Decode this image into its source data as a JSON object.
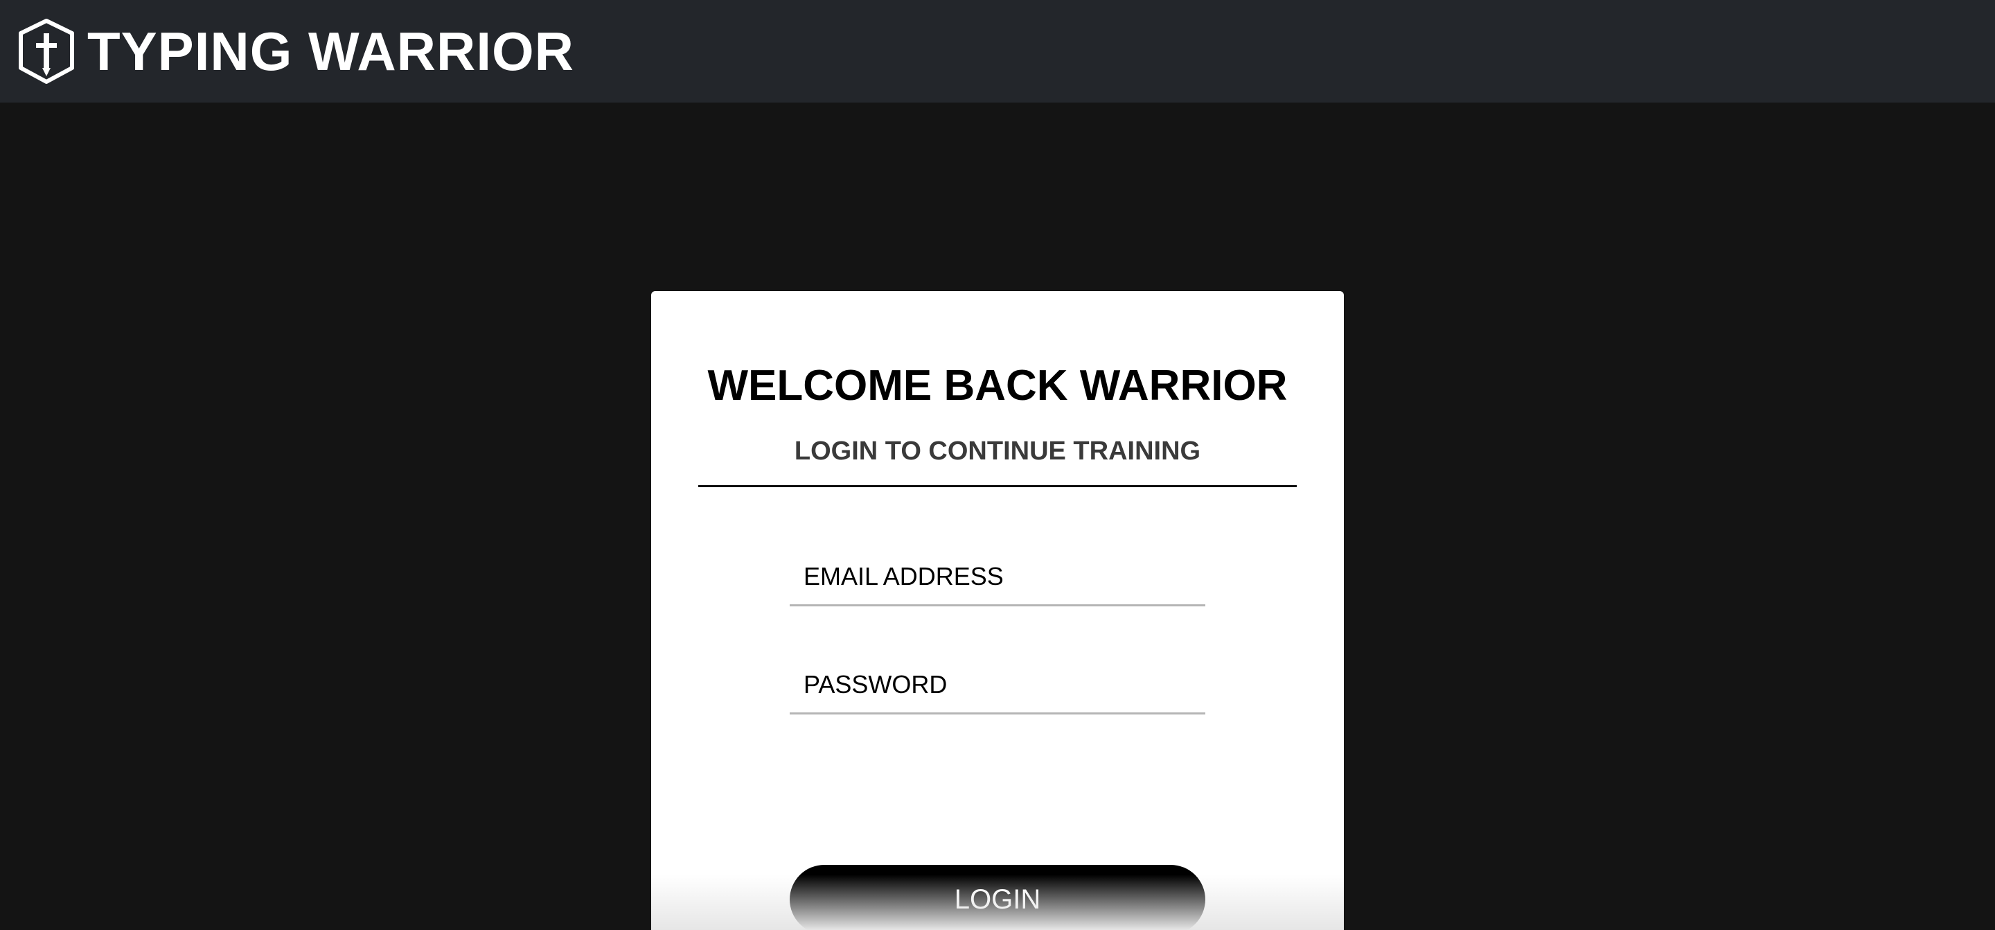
{
  "header": {
    "app_name": "TYPING WARRIOR",
    "logo_icon": "shield-sword-icon",
    "background": "#23262b"
  },
  "login_card": {
    "title": "WELCOME BACK WARRIOR",
    "subtitle": "LOGIN TO CONTINUE TRAINING",
    "email_field": {
      "placeholder": "EMAIL ADDRESS",
      "value": ""
    },
    "password_field": {
      "placeholder": "PASSWORD",
      "value": ""
    },
    "login_button_label": "LOGIN"
  },
  "colors": {
    "page_background": "#141414",
    "card_background": "#ffffff",
    "button_background": "#000000",
    "button_text": "#ffffff"
  }
}
